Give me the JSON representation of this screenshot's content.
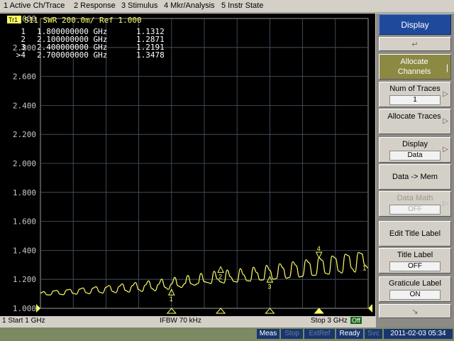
{
  "menu": [
    "1 Active Ch/Trace",
    "2 Response",
    "3 Stimulus",
    "4 Mkr/Analysis",
    "5 Instr State"
  ],
  "trace": {
    "badge": "Tr1",
    "header": "S11  SWR  200.0m/  Ref 1.000",
    "color": "#ffff66",
    "marker_color": "#ffffff"
  },
  "markers": [
    {
      "id": "1",
      "freq": "1.800000000 GHz",
      "value": "1.1312"
    },
    {
      "id": "2",
      "freq": "2.100000000 GHz",
      "value": "1.2871"
    },
    {
      "id": "3",
      "freq": "2.400000000 GHz",
      "value": "1.2191"
    },
    {
      "id": ">4",
      "freq": "2.700000000 GHz",
      "value": "1.3478"
    }
  ],
  "chart_data": {
    "type": "line",
    "ylim": [
      1.0,
      3.0
    ],
    "ytick_labels": [
      "3.000",
      "2.800",
      "2.600",
      "2.400",
      "2.200",
      "2.000",
      "1.800",
      "1.600",
      "1.400",
      "1.200",
      "1.000"
    ],
    "xlim_ghz": [
      1.0,
      3.0
    ],
    "grid": true,
    "series": [
      {
        "x_ghz": [
          1.0,
          1.02,
          1.04,
          1.06,
          1.08,
          1.1,
          1.12,
          1.14,
          1.16,
          1.18,
          1.2,
          1.22,
          1.24,
          1.26,
          1.28,
          1.3,
          1.32,
          1.34,
          1.36,
          1.38,
          1.4,
          1.42,
          1.44,
          1.46,
          1.48,
          1.5,
          1.52,
          1.54,
          1.56,
          1.58,
          1.6,
          1.62,
          1.64,
          1.66,
          1.68,
          1.7,
          1.72,
          1.74,
          1.76,
          1.78,
          1.8,
          1.82,
          1.84,
          1.86,
          1.88,
          1.9,
          1.92,
          1.94,
          1.96,
          1.98,
          2.0,
          2.02,
          2.04,
          2.06,
          2.08,
          2.1,
          2.12,
          2.14,
          2.16,
          2.18,
          2.2,
          2.22,
          2.24,
          2.26,
          2.28,
          2.3,
          2.32,
          2.34,
          2.36,
          2.38,
          2.4,
          2.42,
          2.44,
          2.46,
          2.48,
          2.5,
          2.52,
          2.54,
          2.56,
          2.58,
          2.6,
          2.62,
          2.64,
          2.66,
          2.68,
          2.7,
          2.72,
          2.74,
          2.76,
          2.78,
          2.8,
          2.82,
          2.84,
          2.86,
          2.88,
          2.9,
          2.92,
          2.94,
          2.96,
          2.98,
          3.0
        ],
        "values": [
          1.105,
          1.115,
          1.093,
          1.092,
          1.12,
          1.123,
          1.097,
          1.094,
          1.127,
          1.131,
          1.102,
          1.098,
          1.133,
          1.14,
          1.107,
          1.101,
          1.139,
          1.149,
          1.112,
          1.105,
          1.145,
          1.158,
          1.117,
          1.108,
          1.151,
          1.168,
          1.123,
          1.112,
          1.156,
          1.178,
          1.129,
          1.116,
          1.161,
          1.189,
          1.137,
          1.121,
          1.165,
          1.201,
          1.145,
          1.131,
          1.168,
          1.213,
          1.155,
          1.144,
          1.169,
          1.227,
          1.168,
          1.16,
          1.17,
          1.241,
          1.184,
          1.178,
          1.171,
          1.256,
          1.202,
          1.182,
          1.175,
          1.264,
          1.217,
          1.186,
          1.181,
          1.274,
          1.231,
          1.19,
          1.188,
          1.284,
          1.247,
          1.195,
          1.196,
          1.296,
          1.262,
          1.201,
          1.205,
          1.308,
          1.279,
          1.208,
          1.213,
          1.321,
          1.296,
          1.216,
          1.221,
          1.335,
          1.314,
          1.227,
          1.229,
          1.348,
          1.331,
          1.241,
          1.236,
          1.361,
          1.347,
          1.257,
          1.243,
          1.373,
          1.363,
          1.276,
          1.25,
          1.385,
          1.378,
          1.298,
          1.278
        ]
      }
    ]
  },
  "status": {
    "start": "1  Start 1 GHz",
    "ifbw": "IFBW 70 kHz",
    "stop": "Stop 3 GHz",
    "off": "Off"
  },
  "bottom": {
    "meas": "Meas",
    "stop": "Stop",
    "extref": "ExtRef",
    "ready": "Ready",
    "svc": "Svc",
    "datetime": "2011-02-03 05:34"
  },
  "softkeys": {
    "title": "Display",
    "allocate_channels": "Allocate Channels",
    "num_traces": {
      "label": "Num of Traces",
      "value": "1"
    },
    "allocate_traces": "Allocate Traces",
    "display": {
      "label": "Display",
      "value": "Data"
    },
    "data_mem": "Data -> Mem",
    "data_math": {
      "label": "Data Math",
      "value": "OFF"
    },
    "edit_title": "Edit Title Label",
    "title_label": {
      "label": "Title Label",
      "value": "OFF"
    },
    "graticule_label": {
      "label": "Graticule Label",
      "value": "ON"
    }
  },
  "colors": {
    "softkey_title_bg": "#1f4a9c",
    "softkey_active_bg": "#8c8a42",
    "status_blue": "#19366f"
  }
}
